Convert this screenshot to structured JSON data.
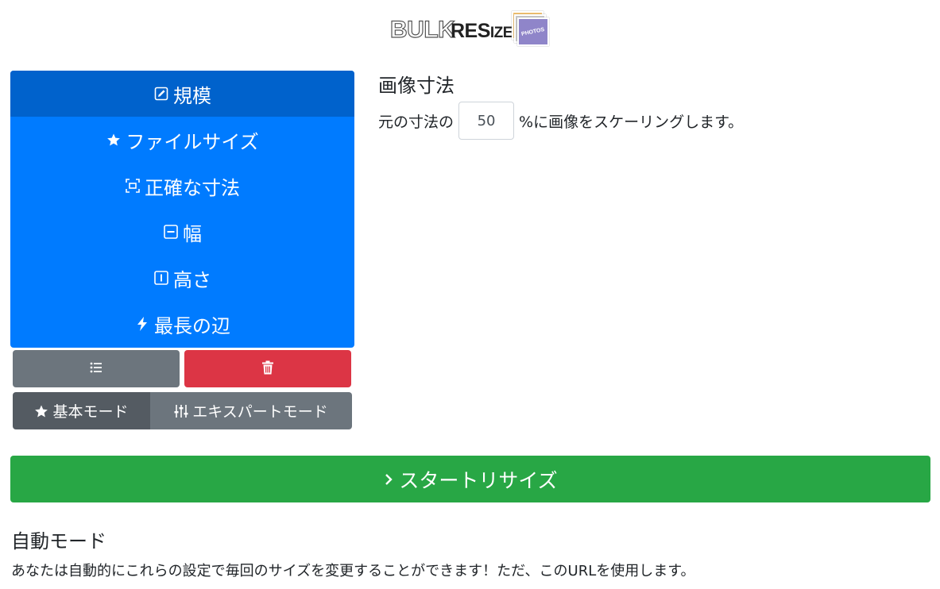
{
  "logo": {
    "bulk": "BULK",
    "resize_big": "RES",
    "resize_small": "IZE",
    "photos": "PHOTOS"
  },
  "nav": {
    "items": [
      {
        "label": "規模",
        "icon": "edit-square-icon",
        "active": true
      },
      {
        "label": "ファイルサイズ",
        "icon": "star-icon",
        "active": false
      },
      {
        "label": "正確な寸法",
        "icon": "crop-frame-icon",
        "active": false
      },
      {
        "label": "幅",
        "icon": "width-box-icon",
        "active": false
      },
      {
        "label": "高さ",
        "icon": "height-box-icon",
        "active": false
      },
      {
        "label": "最長の辺",
        "icon": "bolt-icon",
        "active": false
      }
    ]
  },
  "actions": {
    "list_icon": "list-icon",
    "trash_icon": "trash-icon"
  },
  "modes": {
    "basic_label": "基本モード",
    "expert_label": "エキスパートモード"
  },
  "scale": {
    "title": "画像寸法",
    "prefix": "元の寸法の",
    "value": "50",
    "suffix": "%に画像をスケーリングします。"
  },
  "start": {
    "label": "スタートリサイズ"
  },
  "auto": {
    "title": "自動モード",
    "text": "あなたは自動的にこれらの設定で毎回のサイズを変更することができます！ただ、このURLを使用します。"
  },
  "colors": {
    "primary": "#007bff",
    "primary_active": "#0062cc",
    "secondary": "#6c757d",
    "danger": "#dc3545",
    "success": "#28a745"
  }
}
